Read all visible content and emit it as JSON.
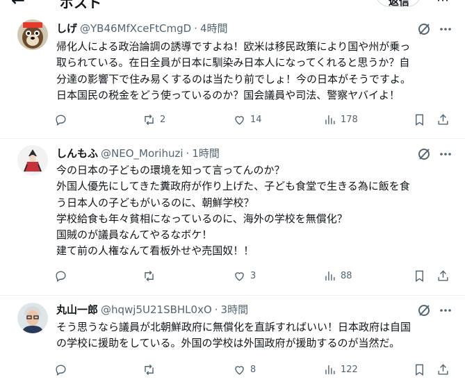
{
  "header": {
    "back_icon": "back-arrow-icon",
    "title": "ポスト",
    "reply_button": "返信"
  },
  "tweets": [
    {
      "name": "しげ",
      "handle": "@YB46MfXceFtCmgD",
      "sep": "·",
      "time": "4時間",
      "lines": [
        "帰化人による政治論調の誘導ですよね！欧米は移民政策により国や州が乗っ",
        "取られている。在日全員が日本に馴染み日本人になってくれると思うか？自",
        "分達の影響下で住み易くするのは当たり前でしょ！今の日本がそうですよ。",
        "日本国民の税金をどう使っているのか？国会議員や司法、警察ヤバイよ！"
      ],
      "reposts": "2",
      "likes": "14",
      "views": "178"
    },
    {
      "name": "しんもふ",
      "handle": "@NEO_Morihuzi",
      "sep": "·",
      "time": "1時間",
      "lines": [
        "今の日本の子どもの環境を知って言ってんのか？",
        "外国人優先にしてきた糞政府が作り上げた、子ども食堂で生きる為に飯を食",
        "う日本人の子どもがいるのに、朝鮮学校？",
        "学校給食も年々貧相になっているのに、海外の学校を無償化？",
        "国賊のが議員なんてやるなボケ！",
        "建て前の人権なんて看板外せや売国奴！！"
      ],
      "reposts": "",
      "likes": "3",
      "views": "88"
    },
    {
      "name": "丸山一郎",
      "handle": "@hqwj5U21SBHL0xO",
      "sep": "·",
      "time": "3時間",
      "lines": [
        "そう思うなら議員が北朝鮮政府に無償化を直訴すればいい！日本政府は自国",
        "の学校に援助をしている。外国の学校は外国政府が援助するのが当然だ。"
      ],
      "reposts": "",
      "likes": "8",
      "views": "122"
    }
  ],
  "icons": {
    "reply": "reply-icon",
    "repost": "repost-icon",
    "like": "like-icon",
    "views": "views-icon",
    "bookmark": "bookmark-icon",
    "share": "share-icon",
    "grok": "grok-icon",
    "more": "more-icon"
  },
  "colors": {
    "text": "#0f1419",
    "secondary": "#536471",
    "border": "#eff3f4"
  }
}
